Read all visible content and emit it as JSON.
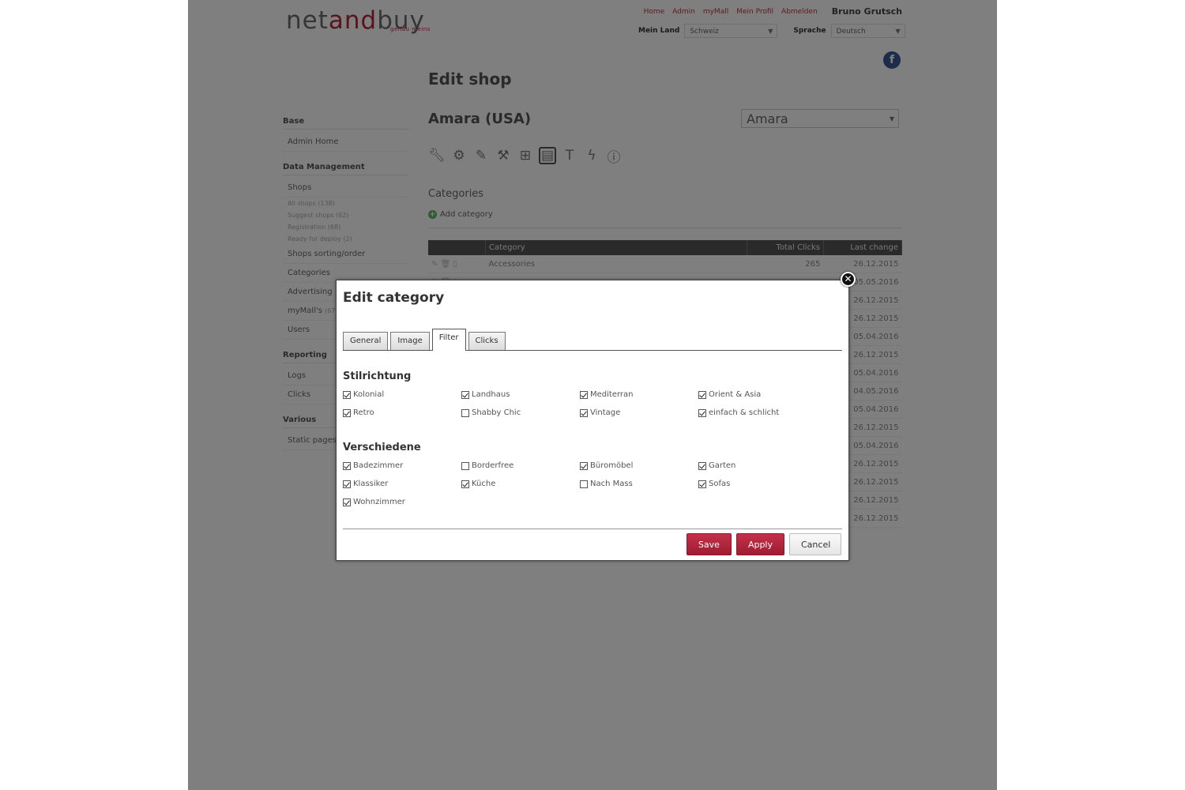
{
  "header": {
    "logo_prefix": "net",
    "logo_accent": "and",
    "logo_suffix": "buy",
    "logo_tagline": "genau meins",
    "nav": [
      "Home",
      "Admin",
      "myMall",
      "Mein Profil",
      "Abmelden"
    ],
    "username": "Bruno Grutsch",
    "country_label": "Mein Land",
    "country_value": "Schweiz",
    "language_label": "Sprache",
    "language_value": "Deutsch",
    "facebook_glyph": "f"
  },
  "sidebar": {
    "sections": [
      {
        "heading": "Base",
        "items": [
          "Admin Home"
        ]
      },
      {
        "heading": "Data Management",
        "items": [
          "Shops"
        ],
        "subitems": [
          "All shops (138)",
          "Suggest shops (62)",
          "Registration (68)",
          "Ready for deploy (2)"
        ],
        "items2": [
          "Shops sorting/order",
          "Categories",
          "Advertising",
          "myMall's",
          "Users"
        ]
      },
      {
        "heading": "Reporting",
        "items": [
          "Logs",
          "Clicks"
        ]
      },
      {
        "heading": "Various",
        "items": [
          "Static pages"
        ]
      }
    ],
    "mymall_count": "(67)"
  },
  "main": {
    "page_title": "Edit shop",
    "shop_title": "Amara (USA)",
    "shop_select_value": "Amara",
    "section_heading": "Categories",
    "add_category_label": "Add category",
    "table": {
      "columns": [
        "Category",
        "Total Clicks",
        "Last change"
      ],
      "rows": [
        {
          "category": "Accessories",
          "clicks": "265",
          "date": "26.12.2015"
        },
        {
          "category": "",
          "clicks": "",
          "date": "05.05.2016"
        },
        {
          "category": "",
          "clicks": "",
          "date": "26.12.2015"
        },
        {
          "category": "",
          "clicks": "",
          "date": "26.12.2015"
        },
        {
          "category": "",
          "clicks": "",
          "date": "05.04.2016"
        },
        {
          "category": "",
          "clicks": "",
          "date": "26.12.2015"
        },
        {
          "category": "",
          "clicks": "",
          "date": "05.04.2016"
        },
        {
          "category": "",
          "clicks": "",
          "date": "04.05.2016"
        },
        {
          "category": "",
          "clicks": "",
          "date": "05.04.2016"
        },
        {
          "category": "",
          "clicks": "",
          "date": "26.12.2015"
        },
        {
          "category": "",
          "clicks": "",
          "date": "05.04.2016"
        },
        {
          "category": "",
          "clicks": "",
          "date": "26.12.2015"
        },
        {
          "category": "",
          "clicks": "",
          "date": "26.12.2015"
        },
        {
          "category": "",
          "clicks": "",
          "date": "26.12.2015"
        },
        {
          "category": "",
          "clicks": "",
          "date": "26.12.2015"
        }
      ]
    }
  },
  "dialog": {
    "title": "Edit category",
    "close_glyph": "✕",
    "tabs": [
      {
        "label": "General",
        "active": false
      },
      {
        "label": "Image",
        "active": false
      },
      {
        "label": "Filter",
        "active": true
      },
      {
        "label": "Clicks",
        "active": false
      }
    ],
    "groups": [
      {
        "title": "Stilrichtung",
        "options": [
          {
            "label": "Kolonial",
            "checked": true
          },
          {
            "label": "Landhaus",
            "checked": true
          },
          {
            "label": "Mediterran",
            "checked": true
          },
          {
            "label": "Orient & Asia",
            "checked": true
          },
          {
            "label": "Retro",
            "checked": true
          },
          {
            "label": "Shabby Chic",
            "checked": false
          },
          {
            "label": "Vintage",
            "checked": true
          },
          {
            "label": "einfach & schlicht",
            "checked": true
          }
        ]
      },
      {
        "title": "Verschiedene",
        "options": [
          {
            "label": "Badezimmer",
            "checked": true
          },
          {
            "label": "Borderfree",
            "checked": false
          },
          {
            "label": "Büromöbel",
            "checked": true
          },
          {
            "label": "Garten",
            "checked": true
          },
          {
            "label": "Klassiker",
            "checked": true
          },
          {
            "label": "Küche",
            "checked": true
          },
          {
            "label": "Nach Mass",
            "checked": false
          },
          {
            "label": "Sofas",
            "checked": true
          },
          {
            "label": "Wohnzimmer",
            "checked": true
          }
        ]
      }
    ],
    "buttons": {
      "save": "Save",
      "apply": "Apply",
      "cancel": "Cancel"
    }
  },
  "colors": {
    "accent": "#b3263a",
    "overlay": "rgba(0,0,0,0.5)"
  }
}
